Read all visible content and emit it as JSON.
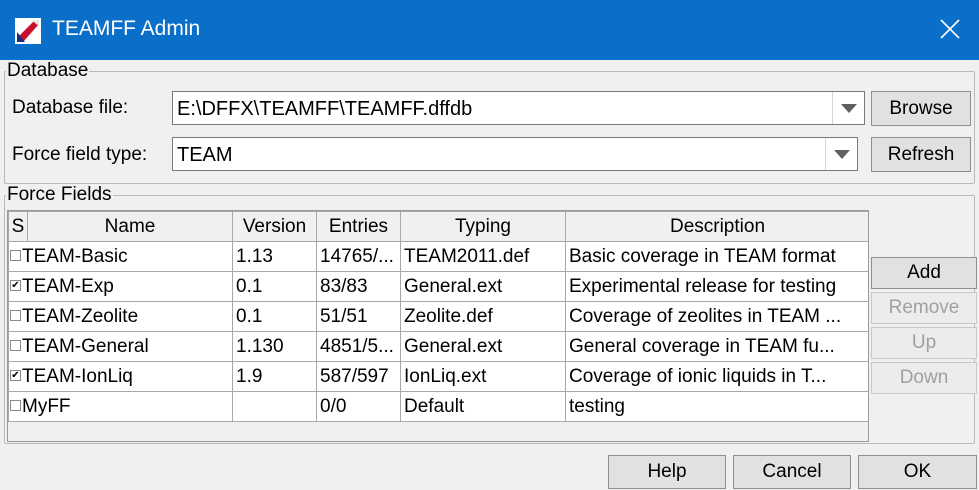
{
  "window": {
    "title": "TEAMFF Admin"
  },
  "database": {
    "legend": "Database",
    "file_label": "Database file:",
    "file_value": "E:\\DFFX\\TEAMFF\\TEAMFF.dffdb",
    "browse_label": "Browse",
    "type_label": "Force field type:",
    "type_value": "TEAM",
    "refresh_label": "Refresh"
  },
  "force_fields": {
    "legend": "Force Fields",
    "columns": [
      "S",
      "Name",
      "Version",
      "Entries",
      "Typing",
      "Description"
    ],
    "rows": [
      {
        "checked": false,
        "name": "TEAM-Basic",
        "version": "1.13",
        "entries": "14765/...",
        "typing": "TEAM2011.def",
        "description": "Basic coverage in TEAM format"
      },
      {
        "checked": true,
        "name": "TEAM-Exp",
        "version": "0.1",
        "entries": "83/83",
        "typing": "General.ext",
        "description": "Experimental release for testing"
      },
      {
        "checked": false,
        "name": "TEAM-Zeolite",
        "version": "0.1",
        "entries": "51/51",
        "typing": "Zeolite.def",
        "description": "Coverage of zeolites in TEAM ..."
      },
      {
        "checked": false,
        "name": "TEAM-General",
        "version": "1.130",
        "entries": "4851/5...",
        "typing": "General.ext",
        "description": "General coverage in TEAM fu..."
      },
      {
        "checked": true,
        "name": "TEAM-IonLiq",
        "version": "1.9",
        "entries": "587/597",
        "typing": "IonLiq.ext",
        "description": "Coverage of ionic liquids in T..."
      },
      {
        "checked": false,
        "name": "MyFF",
        "version": "",
        "entries": "0/0",
        "typing": "Default",
        "description": "testing"
      }
    ],
    "add_label": "Add",
    "remove_label": "Remove",
    "up_label": "Up",
    "down_label": "Down"
  },
  "footer": {
    "help_label": "Help",
    "cancel_label": "Cancel",
    "ok_label": "OK"
  },
  "colors": {
    "titlebar": "#0a6fc9",
    "window_bg": "#f0f0f0"
  },
  "icons": {
    "app": "teamff-app-icon",
    "close": "close-icon",
    "dropdown": "chevron-down-icon"
  }
}
